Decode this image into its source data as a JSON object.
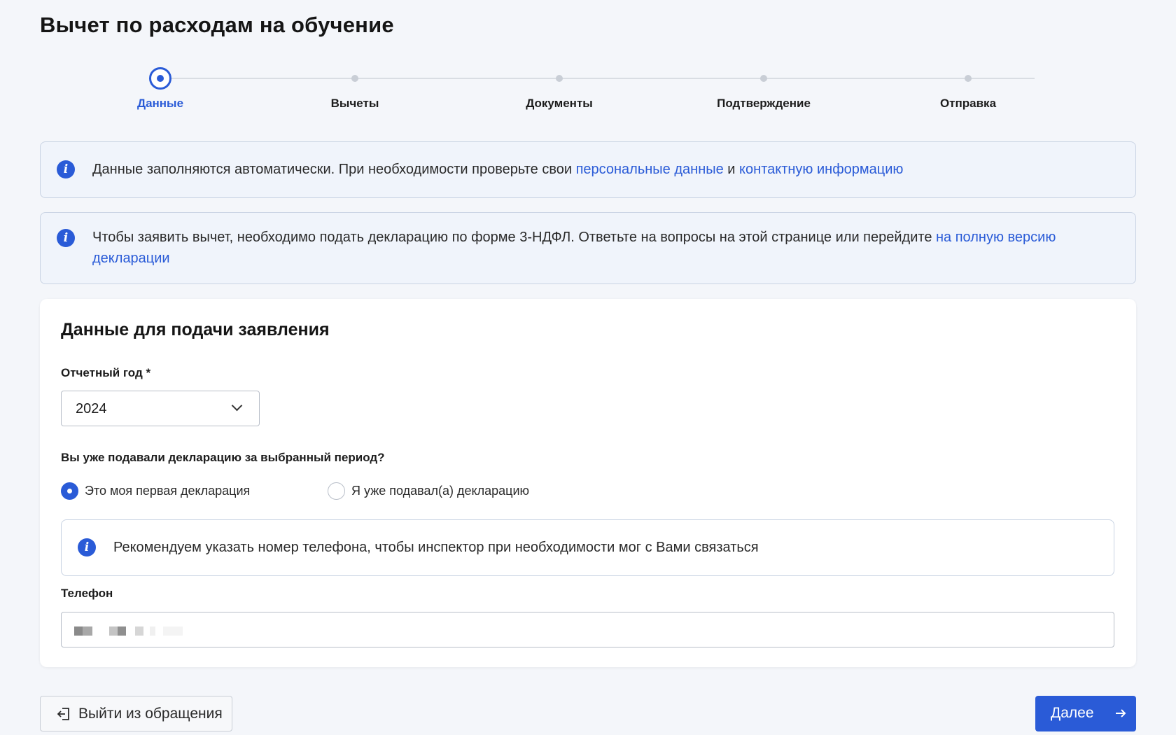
{
  "page": {
    "title": "Вычет по расходам на обучение"
  },
  "stepper": {
    "steps": [
      {
        "label": "Данные",
        "active": true
      },
      {
        "label": "Вычеты",
        "active": false
      },
      {
        "label": "Документы",
        "active": false
      },
      {
        "label": "Подтверждение",
        "active": false
      },
      {
        "label": "Отправка",
        "active": false
      }
    ]
  },
  "info1": {
    "text": "Данные заполняются автоматически. При необходимости проверьте свои ",
    "link1": "персональные данные",
    "joiner": " и ",
    "link2": "контактную информацию"
  },
  "info2": {
    "text": "Чтобы заявить вычет, необходимо подать декларацию по форме 3-НДФЛ. Ответьте на вопросы на этой странице или перейдите ",
    "link": "на полную версию декларации"
  },
  "form": {
    "title": "Данные для подачи заявления",
    "year_label": "Отчетный год *",
    "year_value": "2024",
    "question": "Вы уже подавали декларацию за выбранный период?",
    "radio_first": "Это моя первая декларация",
    "radio_second": "Я уже подавал(а) декларацию",
    "radio_first_checked": true,
    "phone_hint": "Рекомендуем указать номер телефона, чтобы инспектор при необходимости мог с Вами связаться",
    "phone_label": "Телефон"
  },
  "actions": {
    "exit_label": "Выйти из обращения",
    "next_label": "Далее"
  },
  "colors": {
    "accent": "#2a5bd7",
    "info_bg": "#f0f4fb",
    "page_bg": "#f4f6fa"
  },
  "icons": {
    "info": "info-icon",
    "exit": "exit-icon",
    "next": "arrow-right-icon",
    "select": "chevron-down-icon"
  }
}
